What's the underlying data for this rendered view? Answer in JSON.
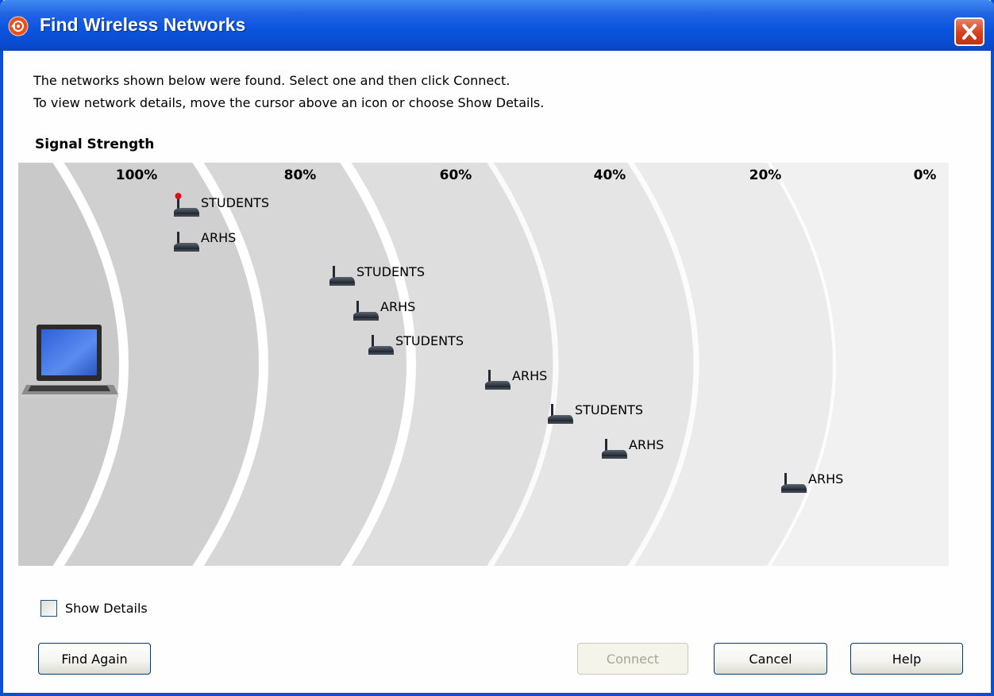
{
  "window": {
    "title": "Find Wireless Networks"
  },
  "intro": {
    "line1": "The networks shown below were found. Select one and then click Connect.",
    "line2": "To view network details, move the cursor above an icon or choose Show Details."
  },
  "signal": {
    "label": "Signal Strength",
    "scale": [
      "100%",
      "80%",
      "60%",
      "40%",
      "20%",
      "0%"
    ]
  },
  "networks": [
    {
      "name": "STUDENTS",
      "signal_pct": 96,
      "connected": true
    },
    {
      "name": "ARHS",
      "signal_pct": 96,
      "connected": false
    },
    {
      "name": "STUDENTS",
      "signal_pct": 76,
      "connected": false
    },
    {
      "name": "ARHS",
      "signal_pct": 73,
      "connected": false
    },
    {
      "name": "STUDENTS",
      "signal_pct": 71,
      "connected": false
    },
    {
      "name": "ARHS",
      "signal_pct": 56,
      "connected": false
    },
    {
      "name": "STUDENTS",
      "signal_pct": 48,
      "connected": false
    },
    {
      "name": "ARHS",
      "signal_pct": 41,
      "connected": false
    },
    {
      "name": "ARHS",
      "signal_pct": 18,
      "connected": false
    }
  ],
  "options": {
    "show_details_label": "Show Details",
    "show_details_checked": false
  },
  "buttons": {
    "find_again": "Find Again",
    "connect": "Connect",
    "cancel": "Cancel",
    "help": "Help"
  },
  "colors": {
    "title_bar": "#0a55df",
    "close_button": "#d4401d",
    "band_darkest": "#c8c8c8",
    "band_lightest": "#f1f1f1",
    "connected_dot": "#e01010"
  },
  "icons": {
    "app": "wireless-app-icon",
    "close": "close-icon",
    "access_point": "access-point-icon",
    "computer": "laptop-icon"
  }
}
